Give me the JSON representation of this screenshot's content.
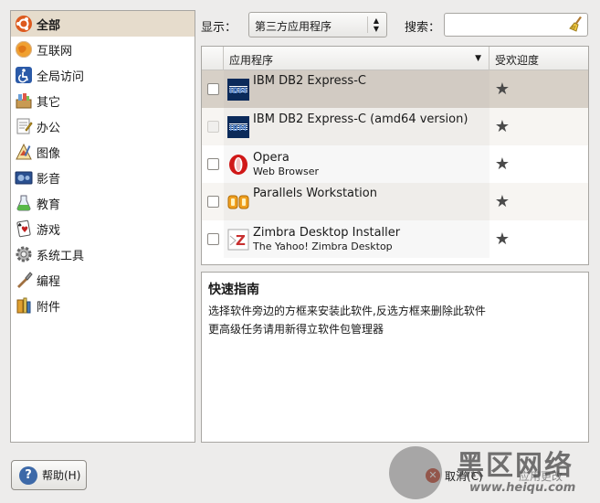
{
  "toolbar": {
    "show_label": "显示：",
    "show_value": "第三方应用程序",
    "search_label": "搜索：",
    "search_value": ""
  },
  "categories": [
    {
      "label": "全部",
      "icon": "ubuntu-icon",
      "selected": true
    },
    {
      "label": "互联网",
      "icon": "globe-icon"
    },
    {
      "label": "全局访问",
      "icon": "accessibility-icon"
    },
    {
      "label": "其它",
      "icon": "other-icon"
    },
    {
      "label": "办公",
      "icon": "office-icon"
    },
    {
      "label": "图像",
      "icon": "graphics-icon"
    },
    {
      "label": "影音",
      "icon": "multimedia-icon"
    },
    {
      "label": "教育",
      "icon": "education-icon"
    },
    {
      "label": "游戏",
      "icon": "games-icon"
    },
    {
      "label": "系统工具",
      "icon": "system-tools-icon"
    },
    {
      "label": "编程",
      "icon": "programming-icon"
    },
    {
      "label": "附件",
      "icon": "accessories-icon"
    }
  ],
  "table": {
    "col_app": "应用程序",
    "col_popularity": "受欢迎度",
    "rows": [
      {
        "name": "IBM DB2 Express-C",
        "desc": "",
        "icon": "ibm-icon",
        "checked": false
      },
      {
        "name": "IBM DB2 Express-C (amd64 version)",
        "desc": "",
        "icon": "ibm-icon",
        "checked": false,
        "disabled": true
      },
      {
        "name": "Opera",
        "desc": "Web Browser",
        "icon": "opera-icon",
        "checked": false
      },
      {
        "name": "Parallels Workstation",
        "desc": "",
        "icon": "parallels-icon",
        "checked": false
      },
      {
        "name": "Zimbra Desktop Installer",
        "desc": "The Yahoo! Zimbra Desktop",
        "icon": "zimbra-icon",
        "checked": false
      }
    ]
  },
  "guide": {
    "title": "快速指南",
    "line1": "选择软件旁边的方框来安装此软件,反选方框来删除此软件",
    "line2": "更高级任务请用新得立软件包管理器"
  },
  "buttons": {
    "help": "帮助(H)",
    "cancel": "取消(C)",
    "apply": "应用更改"
  },
  "watermark": {
    "text": "黑区网络",
    "url": "www.heiqu.com"
  }
}
